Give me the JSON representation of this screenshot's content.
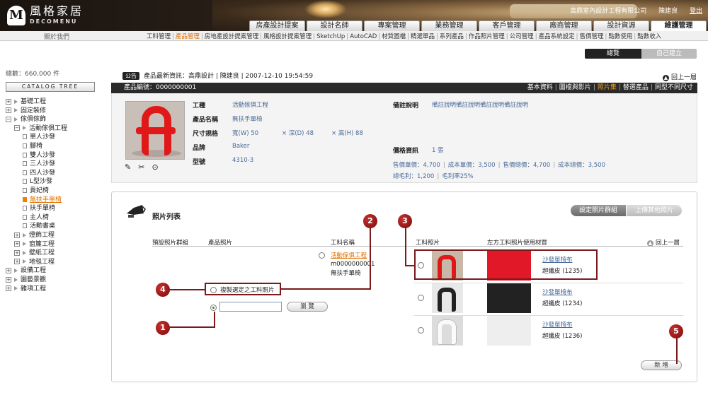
{
  "header": {
    "logo_mark": "M",
    "logo_cn": "風格家居",
    "logo_en": "DECOMENU",
    "company": "高鼎室內設計工程有限公司",
    "user": "陳建良",
    "logout": "登出"
  },
  "tabs": [
    "房產設計提案",
    "設計名師",
    "專案管理",
    "業務管理",
    "客戶管理",
    "廠商管理",
    "設計資源",
    "維護管理"
  ],
  "subnav": {
    "left": "關於我們",
    "items": [
      "工料管理",
      "產品管理",
      "房地產設計提案管理",
      "風格設計提案管理",
      "SketchUp",
      "AutoCAD",
      "材質圖檔",
      "精選單品",
      "系列產品",
      "作品照片管理",
      "公司管理",
      "產品系統設定",
      "售價管理",
      "點數使用",
      "點數收入"
    ],
    "active": "產品管理"
  },
  "mode_tabs": {
    "overview": "總覽",
    "own": "自己建立"
  },
  "sidebar": {
    "total": "總數：660,000 件",
    "catalog_tree": "CATALOG TREE",
    "items": [
      {
        "label": "基礎工程",
        "type": "plus",
        "level": 0
      },
      {
        "label": "固定裝修",
        "type": "plus",
        "level": 0
      },
      {
        "label": "傢俱傢飾",
        "type": "minus",
        "level": 0
      },
      {
        "label": "活動傢俱工程",
        "type": "minus",
        "level": 1
      },
      {
        "label": "單人沙發",
        "type": "doc",
        "level": 2
      },
      {
        "label": "腳椅",
        "type": "doc",
        "level": 2
      },
      {
        "label": "雙人沙發",
        "type": "doc",
        "level": 2
      },
      {
        "label": "三人沙發",
        "type": "doc",
        "level": 2
      },
      {
        "label": "四人沙發",
        "type": "doc",
        "level": 2
      },
      {
        "label": "L型沙發",
        "type": "doc",
        "level": 2
      },
      {
        "label": "貴妃椅",
        "type": "doc",
        "level": 2
      },
      {
        "label": "無扶手單椅",
        "type": "doc-active",
        "level": 2
      },
      {
        "label": "扶手單椅",
        "type": "doc",
        "level": 2
      },
      {
        "label": "主人椅",
        "type": "doc",
        "level": 2
      },
      {
        "label": "活動書桌",
        "type": "doc",
        "level": 2
      },
      {
        "label": "燈飾工程",
        "type": "plus",
        "level": 1
      },
      {
        "label": "窗簾工程",
        "type": "plus",
        "level": 1
      },
      {
        "label": "壁紙工程",
        "type": "plus",
        "level": 1
      },
      {
        "label": "地毯工程",
        "type": "plus",
        "level": 1
      },
      {
        "label": "設備工程",
        "type": "plus",
        "level": 0
      },
      {
        "label": "園藝景觀",
        "type": "plus",
        "level": 0
      },
      {
        "label": "雜項工程",
        "type": "plus",
        "level": 0
      }
    ]
  },
  "news": {
    "badge": "公告",
    "text": "產品最新資訊：高鼎設計 | 陳建良 | 2007-12-10  19:54:59"
  },
  "back_top": "回上一層",
  "product_bar": {
    "number": "產品編號：0000000001",
    "links": [
      "基本資料",
      "圖檔與影片",
      "照片集",
      "替選產品",
      "同型不同尺寸"
    ],
    "active": "照片集"
  },
  "product": {
    "labels": {
      "category": "工種",
      "name": "產品名稱",
      "size": "尺寸規格",
      "brand": "品牌",
      "model": "型號",
      "remark": "備註說明",
      "price": "價格資訊"
    },
    "category": "活動傢俱工程",
    "name": "無扶手單椅",
    "size_w": "寬(W)  50",
    "size_d": "× 深(D) 48",
    "size_h": "× 高(H) 88",
    "brand": "Baker",
    "model": "4310-3",
    "remark": "備註說明備註說明備註說明備註說明",
    "price_count": "1 張",
    "price_line1": [
      "售價單價：4,700",
      "成本單價：3,500",
      "售價總價：4,700",
      "成本總價：3,500"
    ],
    "price_line2": [
      "總毛利：1,200",
      "毛利率25%"
    ]
  },
  "photo_list": {
    "title": "照片列表",
    "btn_set": "設定照片群組",
    "btn_upload": "上傳其他照片",
    "col_group": "預設照片群組",
    "col_product_photo": "產品照片",
    "col_material_name": "工料名稱",
    "col_material_photo": "工料照片",
    "col_materials_used": "左方工料照片使用材質",
    "back": "回上一層",
    "material_link": "活動傢俱工程",
    "material_code": "m0000000001",
    "material_name": "無扶手單椅",
    "option_copy": "複製選定之工料照片",
    "browse": "瀏 覽",
    "add": "新 增",
    "rows": [
      {
        "name": "沙發單椅布",
        "sub": "超纖皮 (1235)",
        "color": "#e01828"
      },
      {
        "name": "沙發單椅布",
        "sub": "超纖皮 (1234)",
        "color": "#222222"
      },
      {
        "name": "沙發單椅布",
        "sub": "超纖皮 (1236)",
        "color": "#eeeeee"
      }
    ]
  },
  "callouts": [
    "1",
    "2",
    "3",
    "4",
    "5"
  ]
}
